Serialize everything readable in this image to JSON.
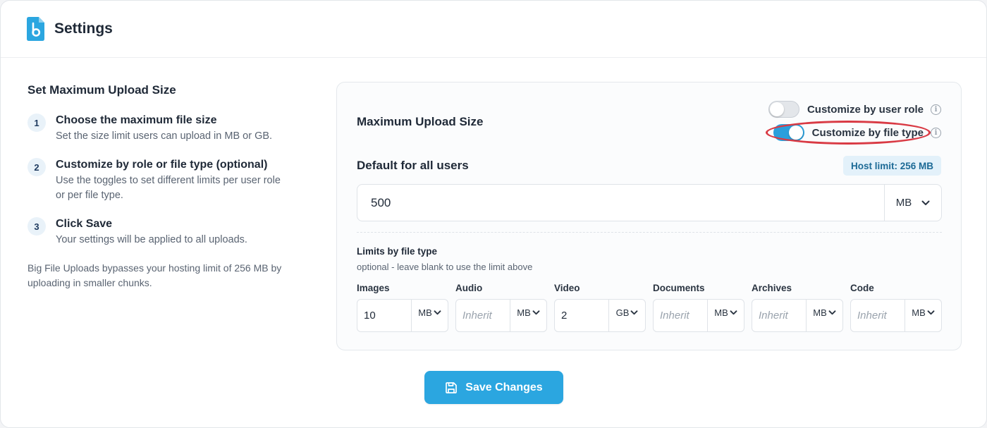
{
  "app": {
    "title": "Settings",
    "logo_icon": "big-file-uploads-logo"
  },
  "colors": {
    "accent": "#2ba6e0",
    "toggle_on": "#2a9fdc",
    "highlight": "#d93a44",
    "badge_bg": "#e3f1fa",
    "badge_text": "#1c6a96"
  },
  "instructions": {
    "title": "Set Maximum Upload Size",
    "steps": [
      {
        "number": "1",
        "title": "Choose the maximum file size",
        "desc": "Set the size limit users can upload in MB or GB."
      },
      {
        "number": "2",
        "title": "Customize by role or file type (optional)",
        "desc": "Use the toggles to set different limits per user role or per file type."
      },
      {
        "number": "3",
        "title": "Click Save",
        "desc": "Your settings will be applied to all uploads."
      }
    ],
    "note": "Big File Uploads bypasses your hosting limit of 256 MB by uploading in smaller chunks."
  },
  "card": {
    "title": "Maximum Upload Size",
    "toggles": [
      {
        "label": "Customize by user role",
        "state": "off",
        "icon": "info-icon"
      },
      {
        "label": "Customize by file type",
        "state": "on",
        "icon": "info-icon"
      }
    ],
    "default_label": "Default for all users",
    "host_limit": "Host limit: 256 MB",
    "default_value": "500",
    "default_unit": "MB",
    "limits_title": "Limits by file type",
    "limits_subtitle": "optional - leave blank to use the limit above",
    "file_types": [
      {
        "label": "Images",
        "value": "10",
        "placeholder": "Inherit",
        "unit": "MB"
      },
      {
        "label": "Audio",
        "value": "",
        "placeholder": "Inherit",
        "unit": "MB"
      },
      {
        "label": "Video",
        "value": "2",
        "placeholder": "Inherit",
        "unit": "GB"
      },
      {
        "label": "Documents",
        "value": "",
        "placeholder": "Inherit",
        "unit": "MB"
      },
      {
        "label": "Archives",
        "value": "",
        "placeholder": "Inherit",
        "unit": "MB"
      },
      {
        "label": "Code",
        "value": "",
        "placeholder": "Inherit",
        "unit": "MB"
      }
    ]
  },
  "save_button": {
    "label": "Save Changes",
    "icon": "floppy-disk-icon"
  }
}
